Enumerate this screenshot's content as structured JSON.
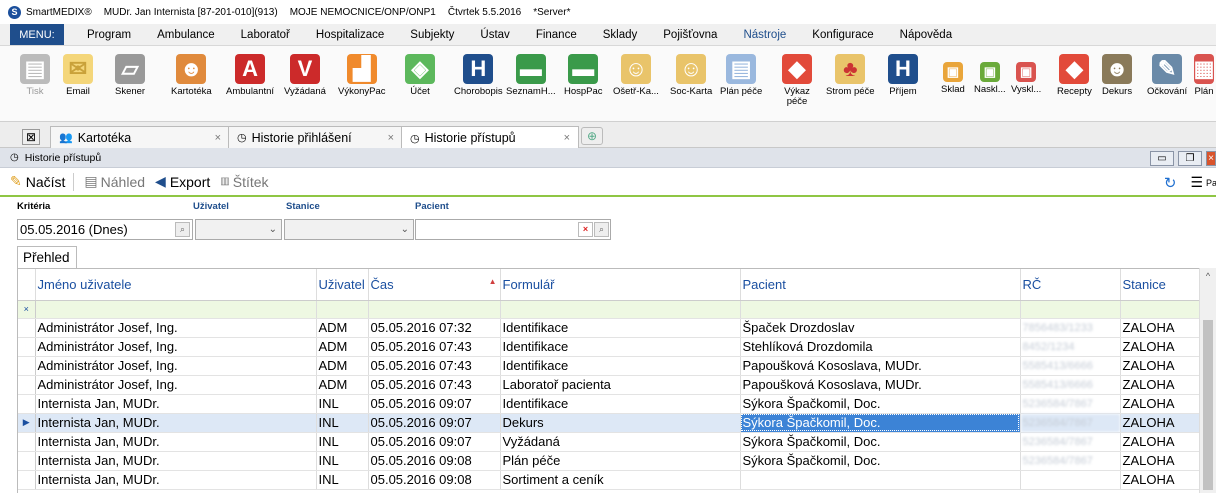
{
  "titlebar": {
    "app": "SmartMEDIX®",
    "user": "MUDr. Jan Internista [87-201-010](913)",
    "location": "MOJE NEMOCNICE/ONP/ONP1",
    "date": "Čtvrtek 5.5.2016",
    "server": "*Server*"
  },
  "menu": {
    "menu_label": "MENU:",
    "items": [
      "Program",
      "Ambulance",
      "Laboratoř",
      "Hospitalizace",
      "Subjekty",
      "Ústav",
      "Finance",
      "Sklady",
      "Pojišťovna",
      "Nástroje",
      "Konfigurace",
      "Nápověda"
    ]
  },
  "ribbon": {
    "tools": [
      "Tisk",
      "Email",
      "Skener",
      "Kartotéka",
      "Ambulantní",
      "Vyžádaná",
      "VýkonyPac",
      "Účet",
      "Chorobopis",
      "SeznamH...",
      "HospPac",
      "Ošetř-Ka...",
      "Soc-Karta",
      "Plán péče",
      "Výkaz péče",
      "Strom péče",
      "Příjem",
      "Sklad",
      "Naskl...",
      "Vyskl...",
      "Recepty",
      "Dekurs",
      "Očkování",
      "Plán"
    ]
  },
  "doc_tabs": [
    "Kartotéka",
    "Historie přihlášení",
    "Historie přístupů"
  ],
  "panel": {
    "title": "Historie přístupů"
  },
  "toolbar": {
    "load": "Načíst",
    "preview": "Náhled",
    "export": "Export",
    "label": "Štítek",
    "right": "Panel"
  },
  "criteria": {
    "title": "Kritéria",
    "user_label": "Uživatel",
    "station_label": "Stanice",
    "patient_label": "Pacient",
    "date_value": "05.05.2016 (Dnes)"
  },
  "subtab": "Přehled",
  "grid": {
    "columns": [
      "Jméno uživatele",
      "Uživatel",
      "Čas",
      "Formulář",
      "Pacient",
      "RČ",
      "Stanice"
    ],
    "rows": [
      {
        "name": "Administrátor Josef, Ing.",
        "user": "ADM",
        "time": "05.05.2016 07:32",
        "form": "Identifikace",
        "patient": "Špaček Drozdoslav",
        "rc": "7856483/1233",
        "station": "ZALOHA"
      },
      {
        "name": "Administrátor Josef, Ing.",
        "user": "ADM",
        "time": "05.05.2016 07:43",
        "form": "Identifikace",
        "patient": "Stehlíková Drozdomila",
        "rc": "8452/1234",
        "station": "ZALOHA"
      },
      {
        "name": "Administrátor Josef, Ing.",
        "user": "ADM",
        "time": "05.05.2016 07:43",
        "form": "Identifikace",
        "patient": "Papoušková Kososlava, MUDr.",
        "rc": "5585413/6666",
        "station": "ZALOHA"
      },
      {
        "name": "Administrátor Josef, Ing.",
        "user": "ADM",
        "time": "05.05.2016 07:43",
        "form": "Laboratoř pacienta",
        "patient": "Papoušková Kososlava, MUDr.",
        "rc": "5585413/6666",
        "station": "ZALOHA"
      },
      {
        "name": "Internista Jan, MUDr.",
        "user": "INL",
        "time": "05.05.2016 09:07",
        "form": "Identifikace",
        "patient": "Sýkora Špačkomil, Doc.",
        "rc": "5236584/7867",
        "station": "ZALOHA"
      },
      {
        "name": "Internista Jan, MUDr.",
        "user": "INL",
        "time": "05.05.2016 09:07",
        "form": "Dekurs",
        "patient": "Sýkora Špačkomil, Doc.",
        "rc": "5236584/7867",
        "station": "ZALOHA"
      },
      {
        "name": "Internista Jan, MUDr.",
        "user": "INL",
        "time": "05.05.2016 09:07",
        "form": "Vyžádaná",
        "patient": "Sýkora Špačkomil, Doc.",
        "rc": "5236584/7867",
        "station": "ZALOHA"
      },
      {
        "name": "Internista Jan, MUDr.",
        "user": "INL",
        "time": "05.05.2016 09:08",
        "form": "Plán péče",
        "patient": "Sýkora Špačkomil, Doc.",
        "rc": "5236584/7867",
        "station": "ZALOHA"
      },
      {
        "name": "Internista Jan, MUDr.",
        "user": "INL",
        "time": "05.05.2016 09:08",
        "form": "Sortiment a ceník",
        "patient": "",
        "rc": "",
        "station": "ZALOHA"
      }
    ]
  },
  "colors": {
    "menu_accent": "#1f4e8c",
    "header_text": "#1a4fa0",
    "toolbar_underline": "#8fc644",
    "selection": "#3c83d6"
  }
}
